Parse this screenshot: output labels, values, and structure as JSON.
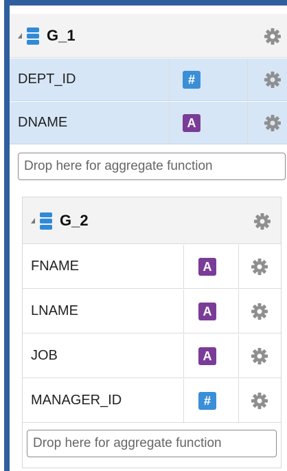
{
  "group1": {
    "title": "G_1",
    "fields": [
      {
        "name": "DEPT_ID",
        "type_icon": "number-icon",
        "type_glyph": "#"
      },
      {
        "name": "DNAME",
        "type_icon": "text-icon",
        "type_glyph": "A"
      }
    ],
    "drop_zone": "Drop here for aggregate function"
  },
  "group2": {
    "title": "G_2",
    "fields": [
      {
        "name": "FNAME",
        "type_icon": "text-icon",
        "type_glyph": "A"
      },
      {
        "name": "LNAME",
        "type_icon": "text-icon",
        "type_glyph": "A"
      },
      {
        "name": "JOB",
        "type_icon": "text-icon",
        "type_glyph": "A"
      },
      {
        "name": "MANAGER_ID",
        "type_icon": "number-icon",
        "type_glyph": "#"
      }
    ],
    "drop_zone": "Drop here for aggregate function"
  },
  "colors": {
    "frame": "#2f5f9e",
    "selected_row": "#d6e6f7",
    "number_badge": "#3a8fd6",
    "text_badge": "#7a3c98",
    "gear": "#8f8f8f"
  }
}
